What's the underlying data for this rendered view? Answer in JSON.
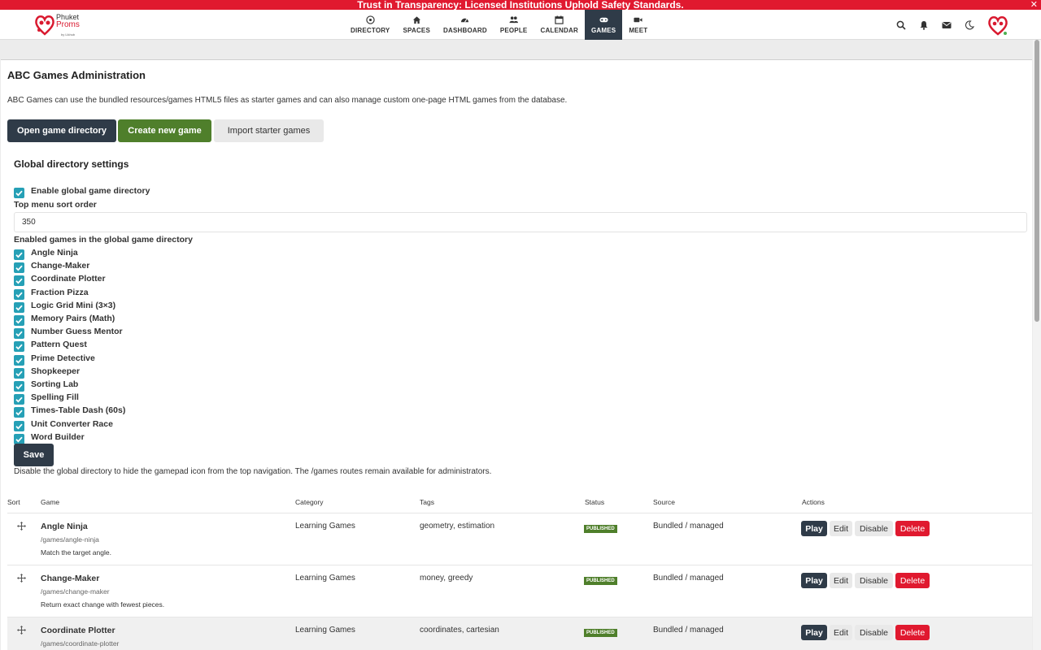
{
  "banner": {
    "text": "Trust in Transparency: Licensed Institutions Uphold Safety Standards.",
    "close": "✕"
  },
  "logo": {
    "line1": "Phuket",
    "line2": "Proms",
    "line3": "by Likhub"
  },
  "nav": {
    "items": [
      {
        "label": "DIRECTORY",
        "icon": "compass-icon"
      },
      {
        "label": "SPACES",
        "icon": "home-icon"
      },
      {
        "label": "DASHBOARD",
        "icon": "gauge-icon"
      },
      {
        "label": "PEOPLE",
        "icon": "people-icon"
      },
      {
        "label": "CALENDAR",
        "icon": "calendar-icon"
      },
      {
        "label": "GAMES",
        "icon": "gamepad-icon",
        "active": true
      },
      {
        "label": "MEET",
        "icon": "video-icon"
      }
    ]
  },
  "page": {
    "title": "ABC Games Administration",
    "description": "ABC Games can use the bundled resources/games HTML5 files as starter games and can also manage custom one-page HTML games from the database.",
    "buttons": {
      "open": "Open game directory",
      "create": "Create new game",
      "import": "Import starter games"
    }
  },
  "settings": {
    "heading": "Global directory settings",
    "enable_label": "Enable global game directory",
    "enable_checked": true,
    "sort_label": "Top menu sort order",
    "sort_value": "350",
    "enabled_label": "Enabled games in the global game directory",
    "games": [
      "Angle Ninja",
      "Change-Maker",
      "Coordinate Plotter",
      "Fraction Pizza",
      "Logic Grid Mini (3×3)",
      "Memory Pairs (Math)",
      "Number Guess Mentor",
      "Pattern Quest",
      "Prime Detective",
      "Shopkeeper",
      "Sorting Lab",
      "Spelling Fill",
      "Times-Table Dash (60s)",
      "Unit Converter Race",
      "Word Builder"
    ],
    "save": "Save",
    "note": "Disable the global directory to hide the gamepad icon from the top navigation. The /games routes remain available for administrators."
  },
  "table": {
    "headers": {
      "sort": "Sort",
      "game": "Game",
      "category": "Category",
      "tags": "Tags",
      "status": "Status",
      "source": "Source",
      "actions": "Actions"
    },
    "actions": {
      "play": "Play",
      "edit": "Edit",
      "disable": "Disable",
      "delete": "Delete"
    },
    "rows": [
      {
        "name": "Angle Ninja",
        "path": "/games/angle-ninja",
        "desc": "Match the target angle.",
        "category": "Learning Games",
        "tags": "geometry, estimation",
        "status": "PUBLISHED",
        "source": "Bundled / managed"
      },
      {
        "name": "Change-Maker",
        "path": "/games/change-maker",
        "desc": "Return exact change with fewest pieces.",
        "category": "Learning Games",
        "tags": "money, greedy",
        "status": "PUBLISHED",
        "source": "Bundled / managed"
      },
      {
        "name": "Coordinate Plotter",
        "path": "/games/coordinate-plotter",
        "desc": "",
        "category": "Learning Games",
        "tags": "coordinates, cartesian",
        "status": "PUBLISHED",
        "source": "Bundled / managed"
      }
    ]
  },
  "colors": {
    "accent_dark": "#2f3b48",
    "green": "#4f7f2b",
    "red": "#e0192f",
    "checkbox": "#26a0b6"
  }
}
